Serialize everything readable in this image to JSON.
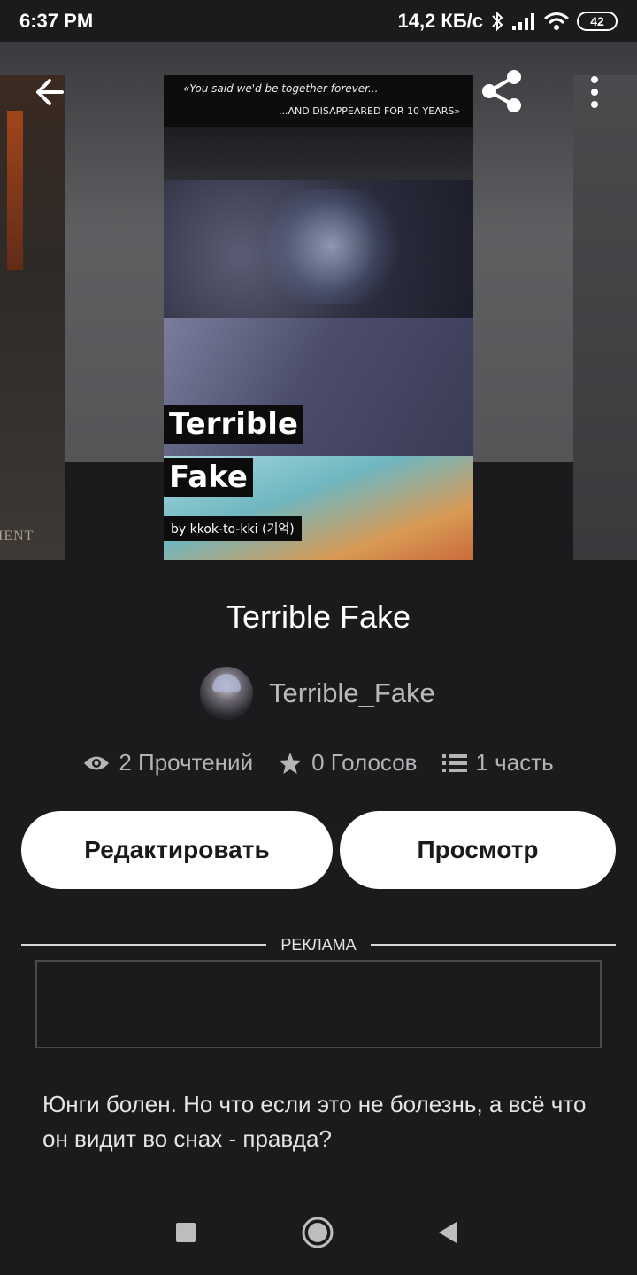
{
  "status_bar": {
    "time": "6:37 PM",
    "network_speed": "14,2 КБ/с",
    "battery": "42",
    "icons": [
      "bluetooth-icon",
      "signal-icon",
      "wifi-icon",
      "battery-icon"
    ]
  },
  "toolbar": {
    "icons": [
      "arrow-left-icon",
      "share-icon",
      "more-vertical-icon"
    ]
  },
  "cover": {
    "quote_line_1": "«You said we'd be together forever...",
    "quote_line_2": "...AND DISAPPEARED FOR 10 YEARS»",
    "title_word_1": "Terrible",
    "title_word_2": "Fake",
    "byline": "by kkok-to-kki (기억)",
    "side_cover_text": "IENT"
  },
  "story": {
    "title": "Terrible Fake",
    "author": "Terrible_Fake",
    "description": "Юнги болен. Но что если это не болезнь, а всё что он видит во снах - правда?"
  },
  "stats": {
    "reads": "2 Прочтений",
    "votes": "0 Голосов",
    "parts": "1 часть",
    "icons": [
      "eye-icon",
      "star-icon",
      "list-icon"
    ]
  },
  "actions": {
    "edit_label": "Редактировать",
    "view_label": "Просмотр"
  },
  "ad": {
    "label": "РЕКЛАМА"
  },
  "navbar": {
    "icons": [
      "square-icon",
      "circle-home-icon",
      "triangle-back-icon"
    ]
  },
  "colors": {
    "background": "#1b1a1d",
    "button_bg": "#ffffff",
    "muted_text": "#b4b4b6"
  }
}
